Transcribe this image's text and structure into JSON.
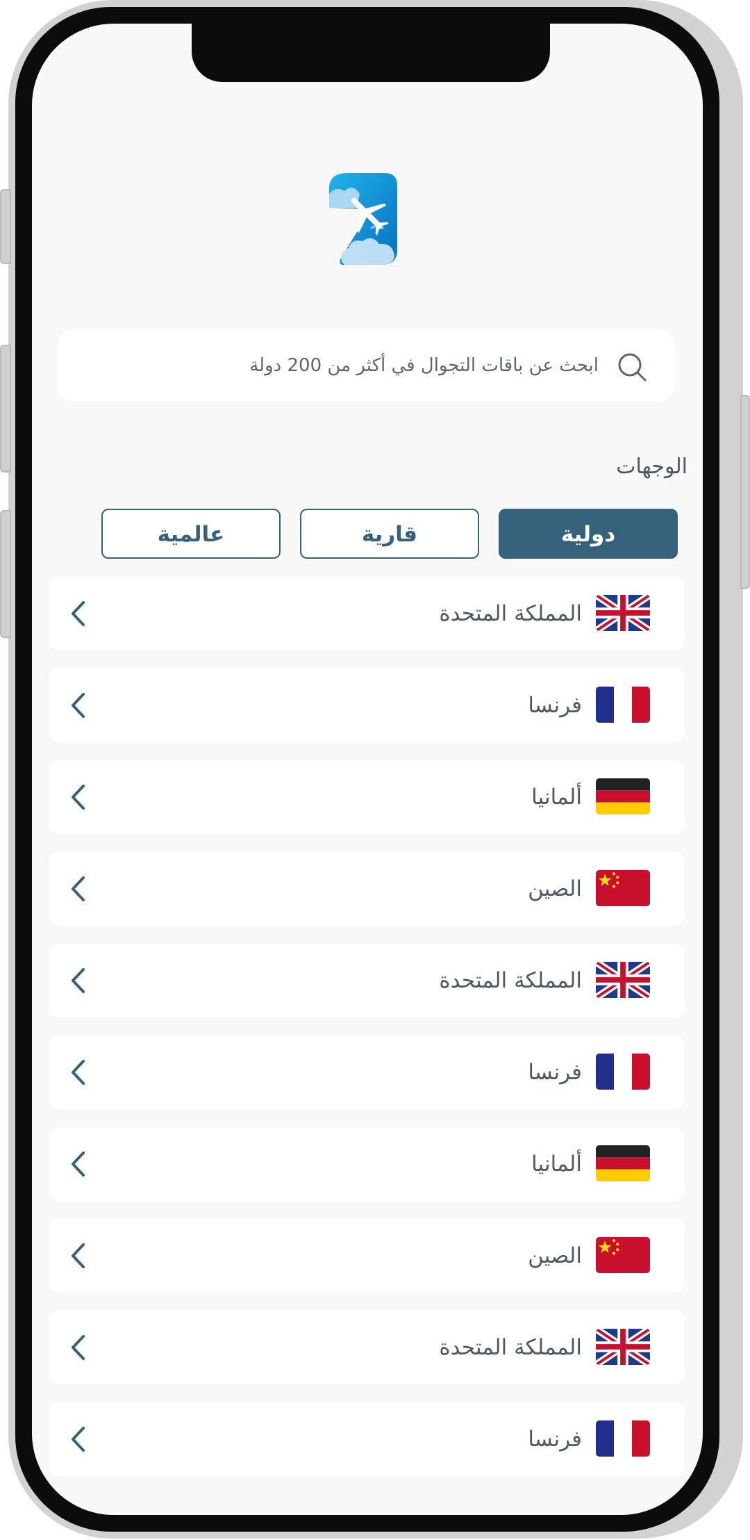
{
  "search": {
    "placeholder": "ابحث عن باقات التجوال في أكثر من 200 دولة"
  },
  "section": {
    "title": "الوجهات"
  },
  "tabs": [
    {
      "label": "دولية",
      "active": true
    },
    {
      "label": "قارية",
      "active": false
    },
    {
      "label": "عالمية",
      "active": false
    }
  ],
  "destinations": [
    {
      "name": "المملكة المتحدة",
      "flag": "uk-flag"
    },
    {
      "name": "فرنسا",
      "flag": "france-flag"
    },
    {
      "name": "ألمانيا",
      "flag": "germany-flag"
    },
    {
      "name": "الصين",
      "flag": "china-flag"
    },
    {
      "name": "المملكة المتحدة",
      "flag": "uk-flag"
    },
    {
      "name": "فرنسا",
      "flag": "france-flag"
    },
    {
      "name": "ألمانيا",
      "flag": "germany-flag"
    },
    {
      "name": "الصين",
      "flag": "china-flag"
    },
    {
      "name": "المملكة المتحدة",
      "flag": "uk-flag"
    },
    {
      "name": "فرنسا",
      "flag": "france-flag"
    }
  ],
  "colors": {
    "accent": "#35627a",
    "background": "#f8f8f8",
    "text": "#4e5862"
  }
}
